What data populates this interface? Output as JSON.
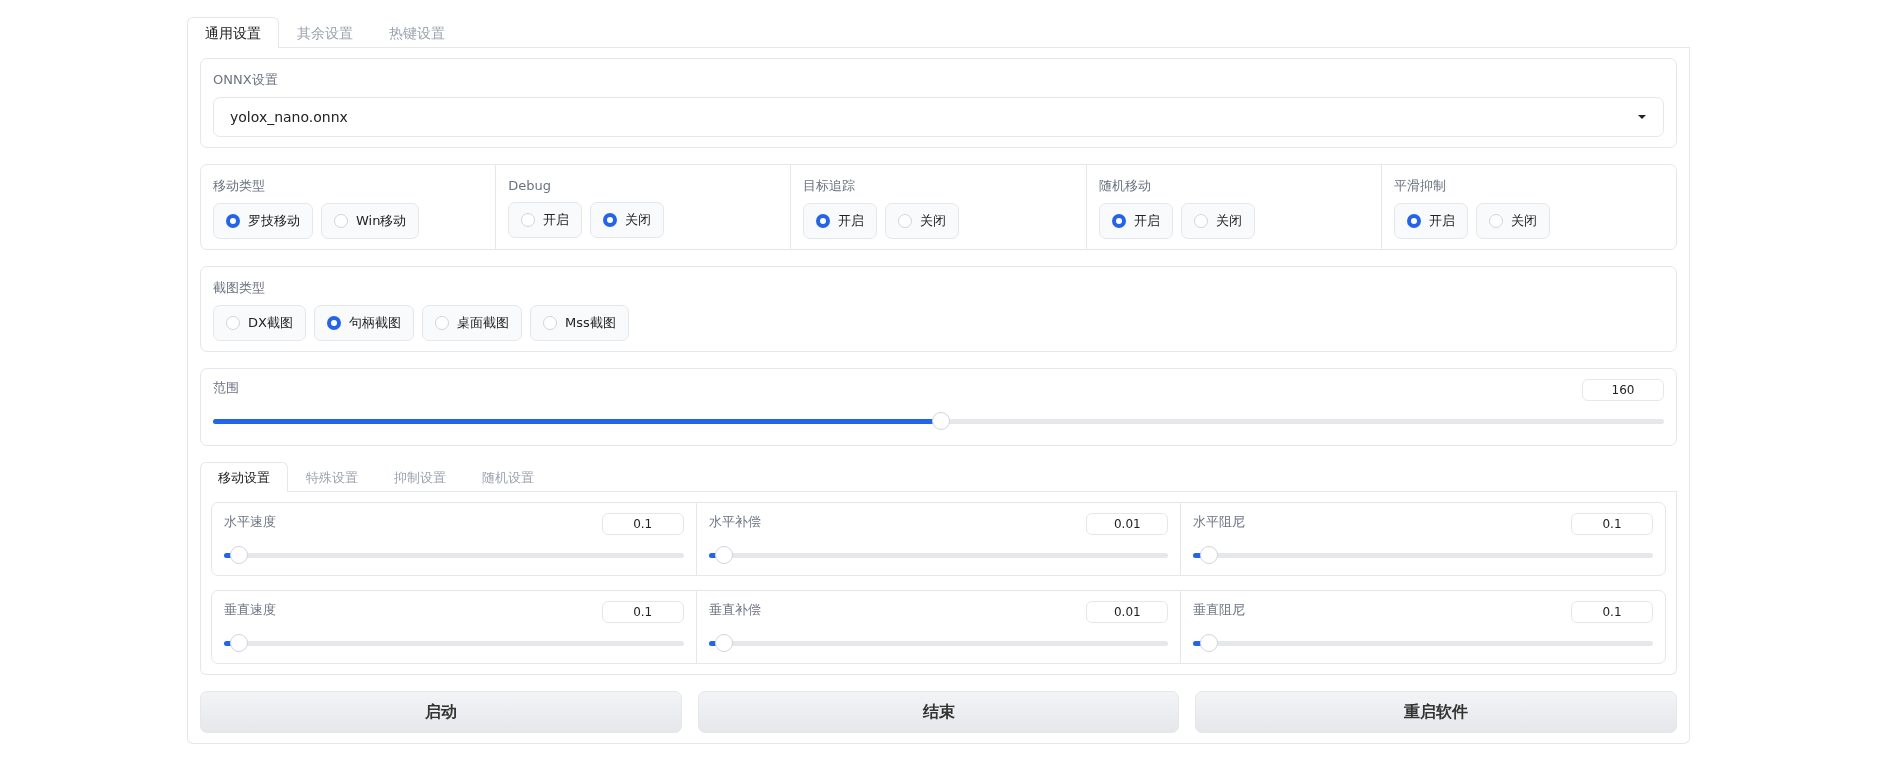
{
  "tabs": [
    {
      "label": "通用设置",
      "selected": true
    },
    {
      "label": "其余设置",
      "selected": false
    },
    {
      "label": "热键设置",
      "selected": false
    }
  ],
  "onnx": {
    "label": "ONNX设置",
    "value": "yolox_nano.onnx"
  },
  "radio_groups": [
    {
      "label": "移动类型",
      "options": [
        {
          "label": "罗技移动",
          "selected": true
        },
        {
          "label": "Win移动",
          "selected": false
        }
      ]
    },
    {
      "label": "Debug",
      "options": [
        {
          "label": "开启",
          "selected": false
        },
        {
          "label": "关闭",
          "selected": true
        }
      ]
    },
    {
      "label": "目标追踪",
      "options": [
        {
          "label": "开启",
          "selected": true
        },
        {
          "label": "关闭",
          "selected": false
        }
      ]
    },
    {
      "label": "随机移动",
      "options": [
        {
          "label": "开启",
          "selected": true
        },
        {
          "label": "关闭",
          "selected": false
        }
      ]
    },
    {
      "label": "平滑抑制",
      "options": [
        {
          "label": "开启",
          "selected": true
        },
        {
          "label": "关闭",
          "selected": false
        }
      ]
    }
  ],
  "capture": {
    "label": "截图类型",
    "options": [
      {
        "label": "DX截图",
        "selected": false
      },
      {
        "label": "句柄截图",
        "selected": true
      },
      {
        "label": "桌面截图",
        "selected": false
      },
      {
        "label": "Mss截图",
        "selected": false
      }
    ]
  },
  "range": {
    "label": "范围",
    "value": "160",
    "level": 0.5
  },
  "sub_tabs": [
    {
      "label": "移动设置",
      "selected": true
    },
    {
      "label": "特殊设置",
      "selected": false
    },
    {
      "label": "抑制设置",
      "selected": false
    },
    {
      "label": "随机设置",
      "selected": false
    }
  ],
  "slider_rows": [
    [
      {
        "label": "水平速度",
        "value": "0.1",
        "level": 0.01
      },
      {
        "label": "水平补偿",
        "value": "0.01",
        "level": 0.01
      },
      {
        "label": "水平阻尼",
        "value": "0.1",
        "level": 0.01
      }
    ],
    [
      {
        "label": "垂直速度",
        "value": "0.1",
        "level": 0.01
      },
      {
        "label": "垂直补偿",
        "value": "0.01",
        "level": 0.01
      },
      {
        "label": "垂直阻尼",
        "value": "0.1",
        "level": 0.01
      }
    ]
  ],
  "buttons": [
    "启动",
    "结束",
    "重启软件"
  ]
}
